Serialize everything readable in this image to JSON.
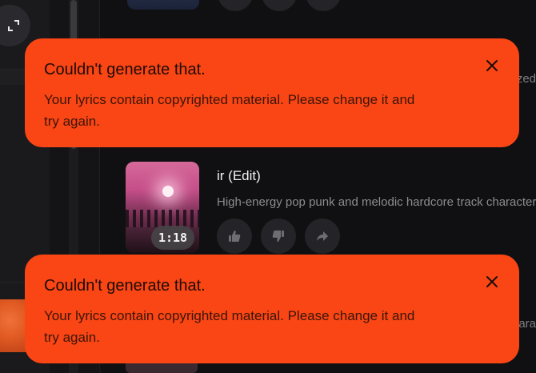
{
  "song": {
    "title": "ir (Edit)",
    "description": "High-energy pop punk and melodic hardcore track characterized",
    "duration": "1:18",
    "cover_icon": "album-art"
  },
  "peek": {
    "upper_fragment": "zed",
    "lower_fragment": "ara"
  },
  "actions": {
    "like_icon": "thumbs-up-icon",
    "dislike_icon": "thumbs-down-icon",
    "share_icon": "share-arrow-icon"
  },
  "toasts": [
    {
      "title": "Couldn't generate that.",
      "message": "Your lyrics contain copyrighted material. Please change it and try again."
    },
    {
      "title": "Couldn't generate that.",
      "message": "Your lyrics contain copyrighted material. Please change it and try again."
    }
  ],
  "colors": {
    "toast_background": "#fa4515",
    "page_background": "#141416",
    "panel_background": "#101012"
  }
}
